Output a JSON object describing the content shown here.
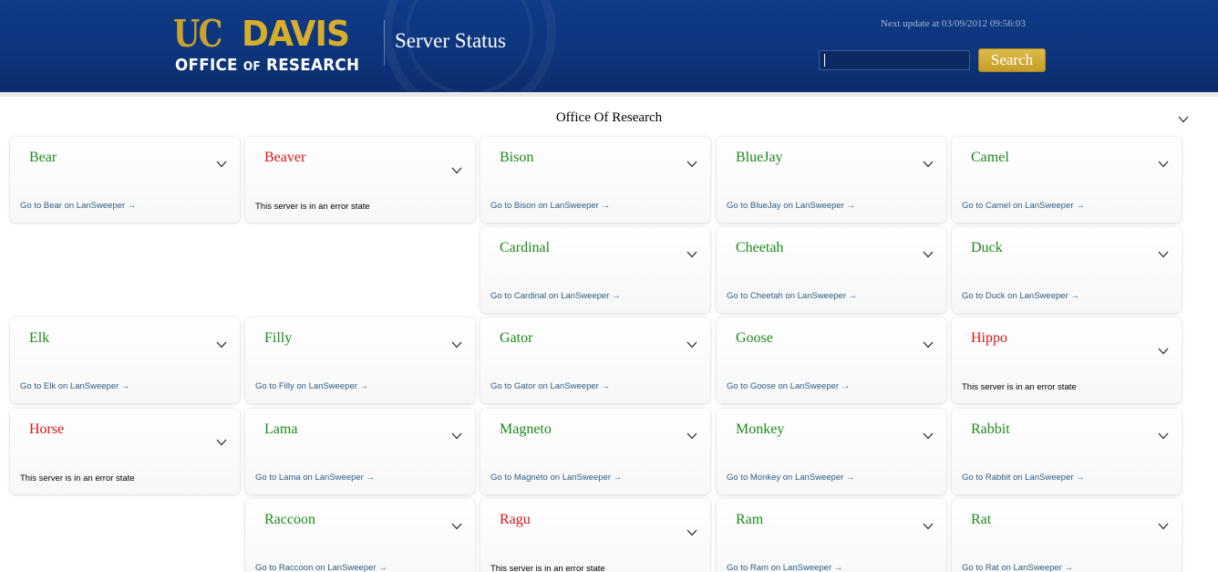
{
  "header": {
    "logo": {
      "uc": "UC",
      "davis": "DAVIS",
      "office": "OFFICE ",
      "of": "OF",
      "research": " RESEARCH"
    },
    "title": "Server Status",
    "next_update": "Next update at 03/09/2012 09:56:03",
    "search": {
      "value": "",
      "button_label": "Search"
    }
  },
  "section": {
    "title": "Office Of Research"
  },
  "colors": {
    "ok": "#1c8a1c",
    "error": "#d8141c",
    "header_bg": "#0e357d",
    "gold": "#d7ad2b"
  },
  "servers": [
    {
      "name": "Bear",
      "status": "ok",
      "link": "Go to Bear on LanSweeper →"
    },
    {
      "name": "Beaver",
      "status": "error",
      "message": "This server is in an error state"
    },
    {
      "name": "Bison",
      "status": "ok",
      "link": "Go to Bison on LanSweeper →"
    },
    {
      "name": "BlueJay",
      "status": "ok",
      "link": "Go to BlueJay on LanSweeper →"
    },
    {
      "name": "Camel",
      "status": "ok",
      "link": "Go to Camel on LanSweeper →"
    },
    {
      "name": "Cardinal",
      "status": "ok",
      "link": "Go to Cardinal on LanSweeper →"
    },
    {
      "name": "Cheetah",
      "status": "ok",
      "link": "Go to Cheetah on LanSweeper →"
    },
    {
      "name": "Duck",
      "status": "ok",
      "link": "Go to Duck on LanSweeper →"
    },
    {
      "name": "Elk",
      "status": "ok",
      "link": "Go to Elk on LanSweeper →"
    },
    {
      "name": "Filly",
      "status": "ok",
      "link": "Go to Filly on LanSweeper →"
    },
    {
      "name": "Gator",
      "status": "ok",
      "link": "Go to Gator on LanSweeper →"
    },
    {
      "name": "Goose",
      "status": "ok",
      "link": "Go to Goose on LanSweeper →"
    },
    {
      "name": "Hippo",
      "status": "error",
      "message": "This server is in an error state"
    },
    {
      "name": "Horse",
      "status": "error",
      "message": "This server is in an error state"
    },
    {
      "name": "Lama",
      "status": "ok",
      "link": "Go to Lama on LanSweeper →"
    },
    {
      "name": "Magneto",
      "status": "ok",
      "link": "Go to Magneto on LanSweeper →"
    },
    {
      "name": "Monkey",
      "status": "ok",
      "link": "Go to Monkey on LanSweeper →"
    },
    {
      "name": "Rabbit",
      "status": "ok",
      "link": "Go to Rabbit on LanSweeper →"
    },
    {
      "name": "Raccoon",
      "status": "ok",
      "link": "Go to Raccoon on LanSweeper →"
    },
    {
      "name": "Ragu",
      "status": "error",
      "message": "This server is in an error state"
    },
    {
      "name": "Ram",
      "status": "ok",
      "link": "Go to Ram on LanSweeper →"
    },
    {
      "name": "Rat",
      "status": "ok",
      "link": "Go to Rat on LanSweeper →"
    }
  ]
}
